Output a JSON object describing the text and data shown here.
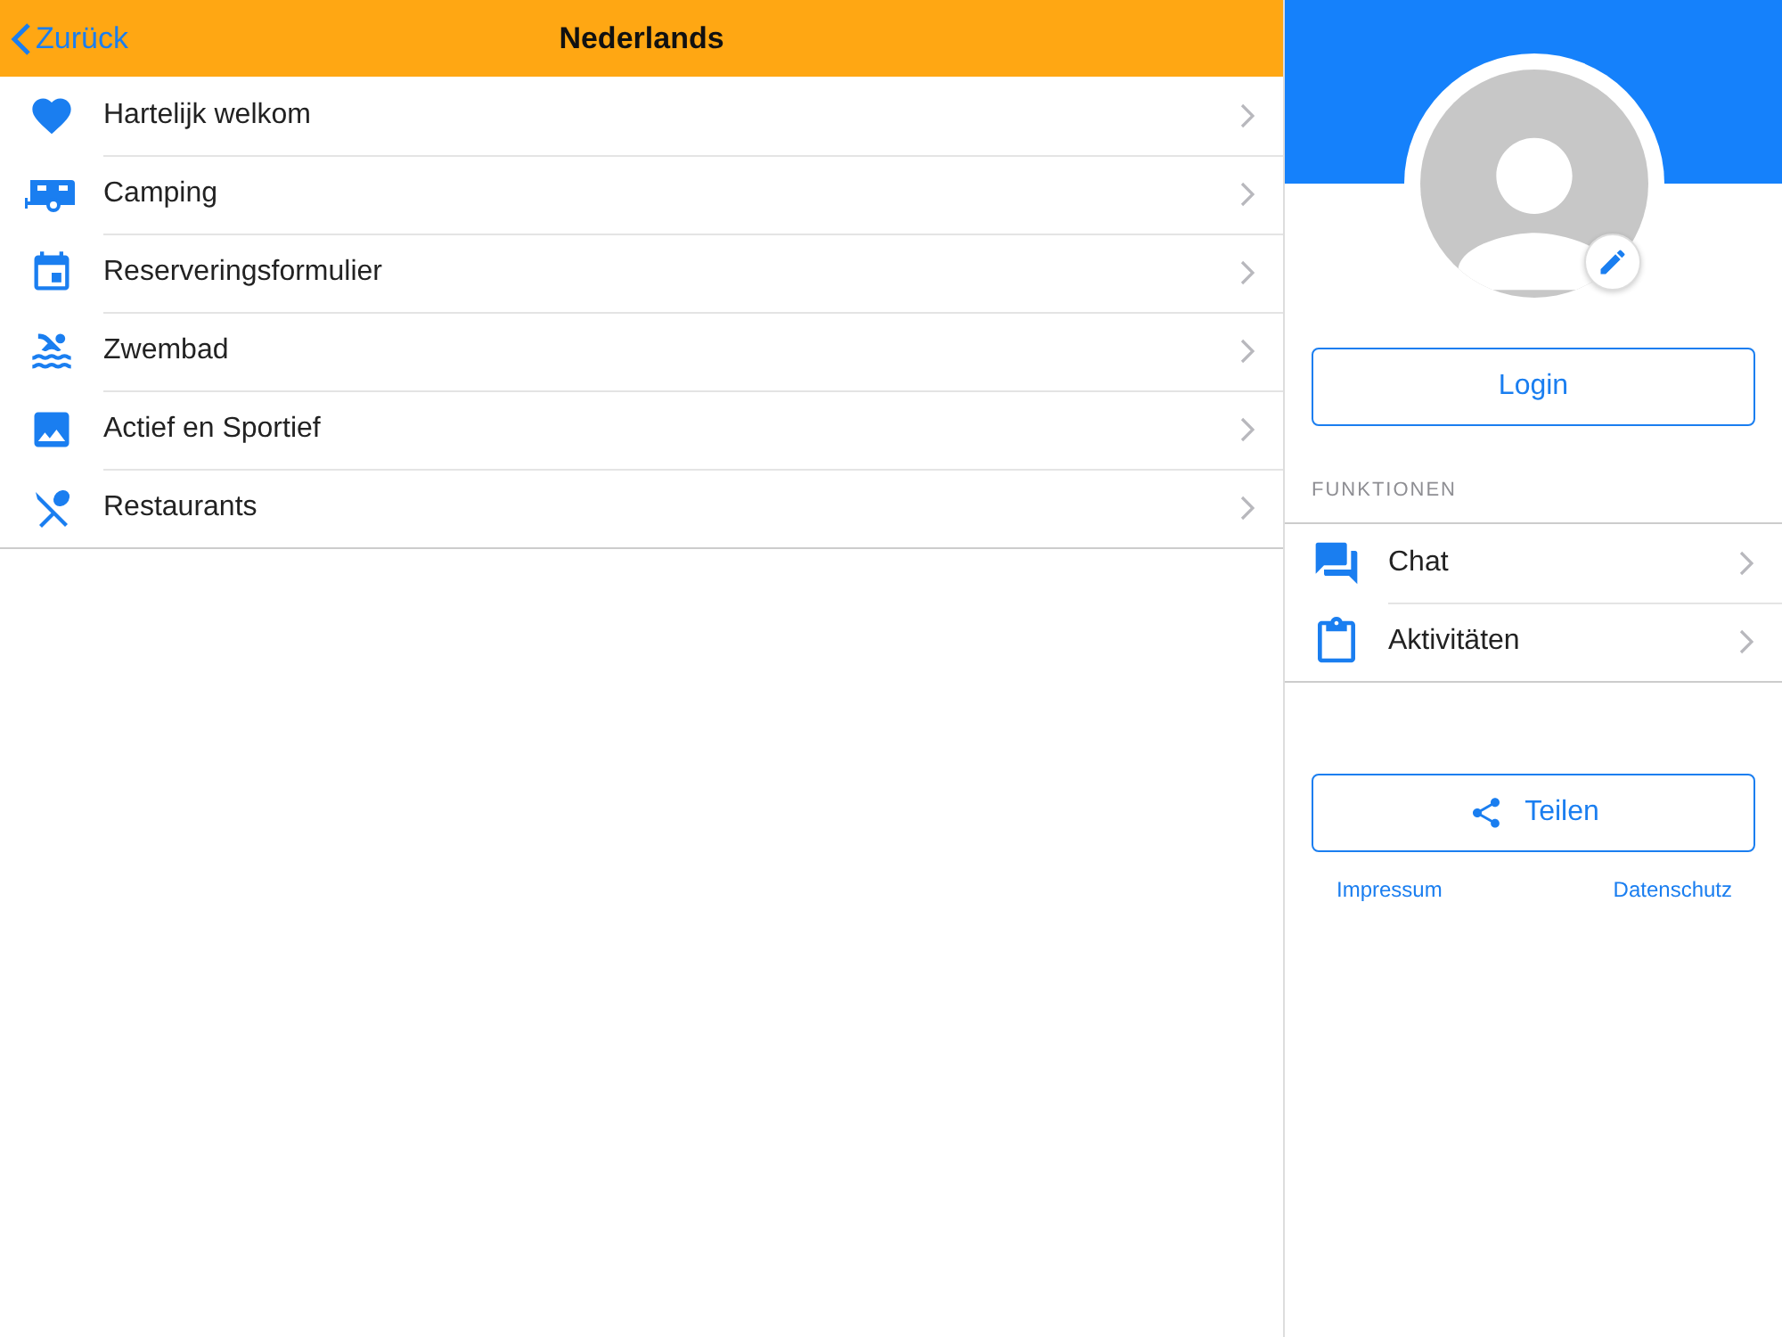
{
  "header": {
    "back": "Zurück",
    "title": "Nederlands"
  },
  "menu": [
    {
      "label": "Hartelijk welkom"
    },
    {
      "label": "Camping"
    },
    {
      "label": "Reserveringsformulier"
    },
    {
      "label": "Zwembad"
    },
    {
      "label": "Actief en Sportief"
    },
    {
      "label": "Restaurants"
    }
  ],
  "profile": {
    "login": "Login",
    "section": "FUNKTIONEN",
    "functions": [
      {
        "label": "Chat"
      },
      {
        "label": "Aktivitäten"
      }
    ],
    "share": "Teilen",
    "links": [
      "Impressum",
      "Datenschutz"
    ]
  }
}
